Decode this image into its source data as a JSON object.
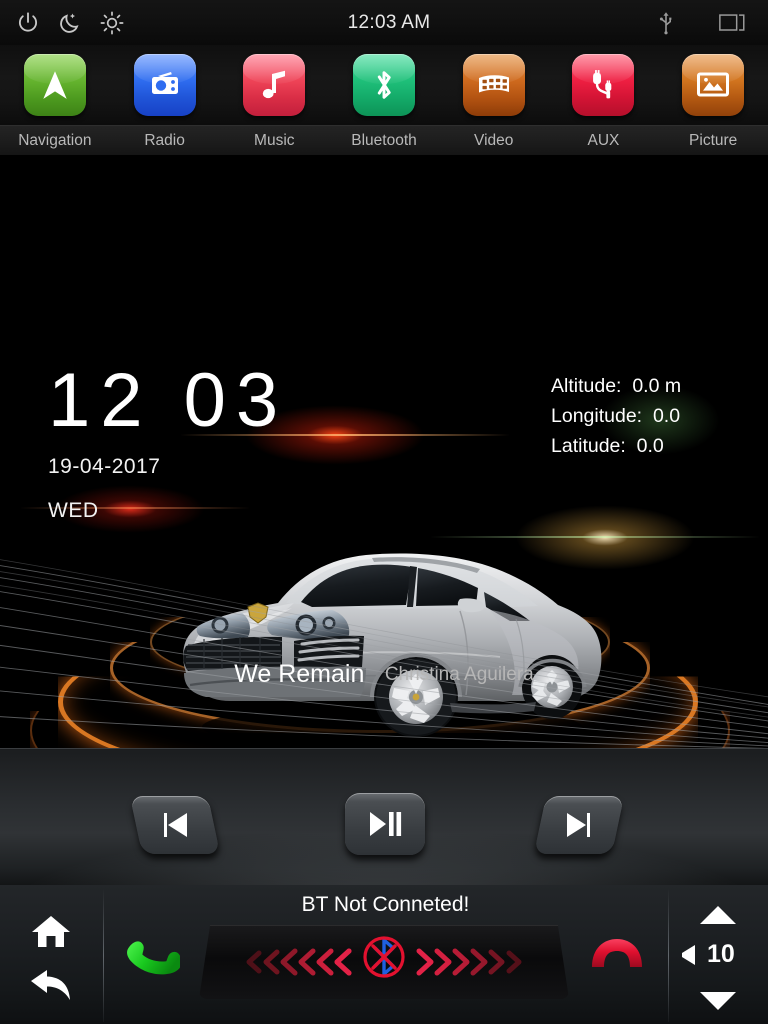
{
  "status_bar": {
    "power_icon": "power-icon",
    "night_icon": "moon-night-mode-icon",
    "brightness_icon": "brightness-icon",
    "time": "12:03 AM",
    "usb_icon": "usb-icon",
    "recents_icon": "recent-apps-icon"
  },
  "apps": [
    {
      "label": "Navigation",
      "icon": "navigation-arrow-icon",
      "color": "#63b22d",
      "color2": "#3d8216"
    },
    {
      "label": "Radio",
      "icon": "radio-icon",
      "color": "#2f6df0",
      "color2": "#1741c6"
    },
    {
      "label": "Music",
      "icon": "music-note-icon",
      "color": "#ef4458",
      "color2": "#c31f3c"
    },
    {
      "label": "Bluetooth",
      "icon": "bluetooth-icon",
      "color": "#1fc07a",
      "color2": "#0d9357"
    },
    {
      "label": "Video",
      "icon": "film-strip-icon",
      "color": "#cf6a1e",
      "color2": "#8e3c08"
    },
    {
      "label": "AUX",
      "icon": "aux-cable-icon",
      "color": "#ef1f42",
      "color2": "#b50f2b"
    },
    {
      "label": "Picture",
      "icon": "picture-image-icon",
      "color": "#d2751f",
      "color2": "#91410a"
    }
  ],
  "home": {
    "clock_time": "12 03",
    "date": "19-04-2017",
    "weekday": "WED",
    "gps": {
      "altitude_label": "Altitude:",
      "altitude_value": "0.0 m",
      "longitude_label": "Longitude:",
      "longitude_value": "0.0",
      "latitude_label": "Latitude:",
      "latitude_value": "0.0"
    },
    "car_image": "silver-suv-car-image",
    "now_playing": {
      "title": "We Remain",
      "artist": "Christina Aguilera"
    }
  },
  "media_controls": {
    "previous_icon": "previous-track-icon",
    "play_pause_icon": "play-pause-icon",
    "next_icon": "next-track-icon"
  },
  "bottom_bar": {
    "home_icon": "home-icon",
    "back_icon": "back-arrow-icon",
    "answer_call_icon": "answer-call-icon",
    "end_call_icon": "end-call-icon",
    "bt_status_text": "BT Not Conneted!",
    "bt_disconnected_icon": "bluetooth-disconnected-icon",
    "volume": {
      "up_icon": "volume-up-arrow-icon",
      "down_icon": "volume-down-arrow-icon",
      "speaker_icon": "speaker-icon",
      "level": "10"
    }
  },
  "colors": {
    "accent_orange": "#ff8c28",
    "status_red": "#e01030",
    "answer_green": "#14c217",
    "bluetooth_blue": "#1f5fe0"
  }
}
